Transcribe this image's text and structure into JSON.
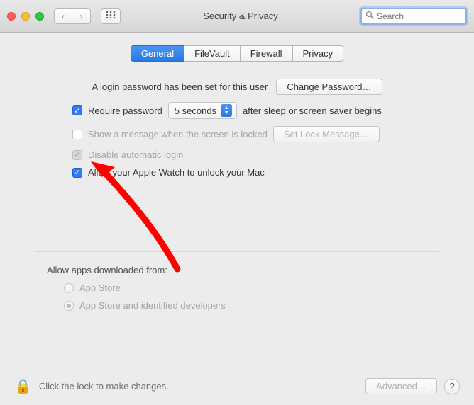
{
  "window": {
    "title": "Security & Privacy"
  },
  "search": {
    "placeholder": "Search"
  },
  "tabs": {
    "general": "General",
    "filevault": "FileVault",
    "firewall": "Firewall",
    "privacy": "Privacy"
  },
  "general": {
    "login_password_set": "A login password has been set for this user",
    "change_password_btn": "Change Password…",
    "require_password": "Require password",
    "require_password_delay": "5 seconds",
    "after_sleep": "after sleep or screen saver begins",
    "show_message": "Show a message when the screen is locked",
    "set_lock_message_btn": "Set Lock Message…",
    "disable_auto_login": "Disable automatic login",
    "apple_watch_unlock": "Allow your Apple Watch to unlock your Mac",
    "allow_apps_label": "Allow apps downloaded from:",
    "app_store": "App Store",
    "app_store_identified": "App Store and identified developers"
  },
  "footer": {
    "lock_text": "Click the lock to make changes.",
    "advanced_btn": "Advanced…"
  },
  "state": {
    "active_tab": "general",
    "require_password_checked": true,
    "show_message_checked": false,
    "disable_auto_login_checked": true,
    "apple_watch_checked": true,
    "download_selection": "identified",
    "locked": true
  }
}
